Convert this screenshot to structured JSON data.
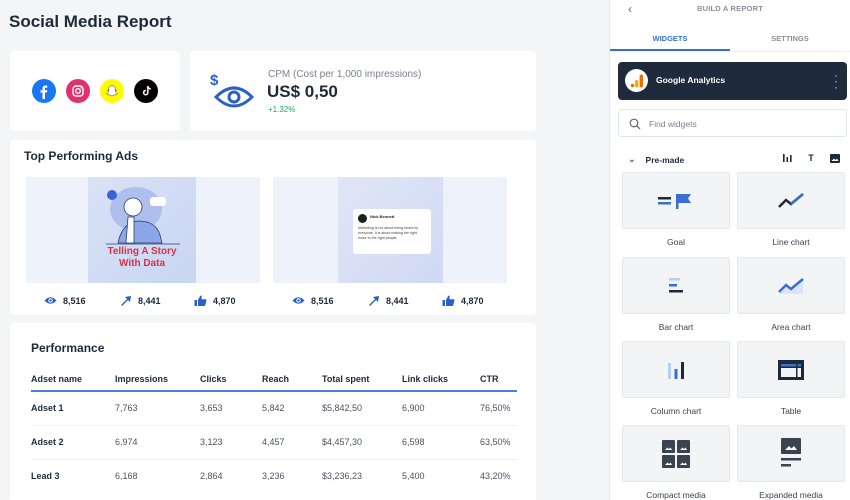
{
  "page": {
    "title": "Social Media Report"
  },
  "social": {
    "platforms": [
      {
        "name": "Facebook",
        "icon": "facebook-icon",
        "color": "#1877f2"
      },
      {
        "name": "Instagram",
        "icon": "instagram-icon",
        "color": "#e1306c"
      },
      {
        "name": "Snapchat",
        "icon": "snapchat-icon",
        "color": "#fffc00"
      },
      {
        "name": "TikTok",
        "icon": "tiktok-icon",
        "color": "#000000"
      }
    ]
  },
  "cpm": {
    "label": "CPM (Cost per 1,000 impressions)",
    "value": "US$ 0,50",
    "change": "+1.32%",
    "icon": "dollar-eye-icon"
  },
  "ads": {
    "title": "Top Performing Ads",
    "items": [
      {
        "caption_line1": "Telling A Story",
        "caption_line2": "With Data",
        "stats": {
          "views": "8,516",
          "clicks": "8,441",
          "likes": "4,870"
        }
      },
      {
        "quote_author": "Nick Bennett",
        "quote_text": "Marketing is not about being heard by everyone. It is about making the right noise to the right people.",
        "stats": {
          "views": "8,516",
          "clicks": "8,441",
          "likes": "4,870"
        }
      }
    ]
  },
  "performance": {
    "title": "Performance",
    "columns": [
      "Adset name",
      "Impressions",
      "Clicks",
      "Reach",
      "Total spent",
      "Link clicks",
      "CTR"
    ],
    "rows": [
      [
        "Adset 1",
        "7,763",
        "3,653",
        "5,842",
        "$5,842,50",
        "6,900",
        "76,50%"
      ],
      [
        "Adset 2",
        "6,974",
        "3,123",
        "4,457",
        "$4,457,30",
        "6,598",
        "63,50%"
      ],
      [
        "Lead 3",
        "6,168",
        "2,864",
        "3,236",
        "$3,236,23",
        "5,400",
        "43,20%"
      ]
    ]
  },
  "sidebar": {
    "back_icon": "chevron-left-icon",
    "title": "BUILD A REPORT",
    "tabs": [
      {
        "label": "WIDGETS",
        "active": true
      },
      {
        "label": "SETTINGS",
        "active": false
      }
    ],
    "source": {
      "name": "Google Analytics",
      "icon": "google-analytics-icon"
    },
    "search": {
      "placeholder": "Find widgets",
      "value": ""
    },
    "section": {
      "label": "Pre-made",
      "tools": [
        "chart-filter-icon",
        "text-filter-icon",
        "image-filter-icon"
      ],
      "text_tool_label": "T"
    },
    "widgets": [
      {
        "label": "Goal",
        "icon": "goal-icon"
      },
      {
        "label": "Line chart",
        "icon": "line-chart-icon"
      },
      {
        "label": "Bar chart",
        "icon": "bar-chart-icon"
      },
      {
        "label": "Area chart",
        "icon": "area-chart-icon"
      },
      {
        "label": "Column chart",
        "icon": "column-chart-icon"
      },
      {
        "label": "Table",
        "icon": "table-icon"
      },
      {
        "label": "Compact media",
        "icon": "compact-media-icon"
      },
      {
        "label": "Expanded media",
        "icon": "expanded-media-icon"
      }
    ]
  },
  "colors": {
    "accent": "#3a6fd1",
    "dark_panel": "#1f2a3c",
    "positive": "#27a36b",
    "caption_red": "#d6334a"
  }
}
